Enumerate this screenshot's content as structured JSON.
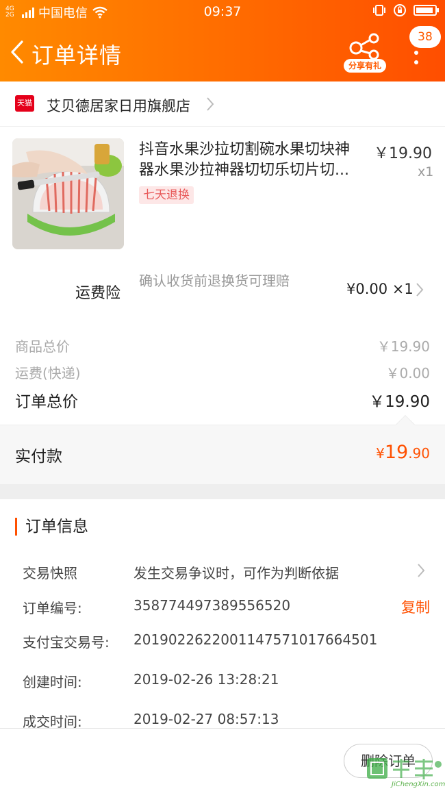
{
  "status_bar": {
    "network": "4G 2G",
    "carrier": "中国电信",
    "time": "09:37"
  },
  "header": {
    "back_icon": "chevron-left-icon",
    "title": "订单详情",
    "share_label": "分享有礼",
    "message_count": "38",
    "colors": {
      "gradient_start": "#ff8a00",
      "gradient_end": "#ff4e00"
    }
  },
  "shop": {
    "badge": "天猫",
    "name": "艾贝德居家日用旗舰店"
  },
  "product": {
    "title": "抖音水果沙拉切割碗水果切块神器水果沙拉神器切切乐切片切...",
    "price": "￥19.90",
    "quantity": "x1",
    "tag": "七天退换"
  },
  "insurance": {
    "label": "运费险",
    "description": "确认收货前退换货可理赔",
    "price": "¥0.00 ×1"
  },
  "summary": {
    "goods_label": "商品总价",
    "goods_value": "￥19.90",
    "shipping_label": "运费(快递)",
    "shipping_value": "￥0.00",
    "total_label": "订单总价",
    "total_value": "￥19.90"
  },
  "paid": {
    "label": "实付款",
    "currency": "¥",
    "integer": "19",
    "decimal": ".90",
    "color": "#ff5000"
  },
  "order_info": {
    "title": "订单信息",
    "snapshot_label": "交易快照",
    "snapshot_value": "发生交易争议时，可作为判断依据",
    "order_no_label": "订单编号:",
    "order_no_value": "358774497389556520",
    "copy_label": "复制",
    "alipay_label": "支付宝交易号:",
    "alipay_value": "2019022622001147571017664501",
    "created_label": "创建时间:",
    "created_value": "2019-02-26 13:28:21",
    "deal_label": "成交时间:",
    "deal_value": "2019-02-27 08:57:13"
  },
  "footer": {
    "delete_label": "删除订单"
  },
  "watermark": {
    "text": "JiChengXin.com"
  }
}
